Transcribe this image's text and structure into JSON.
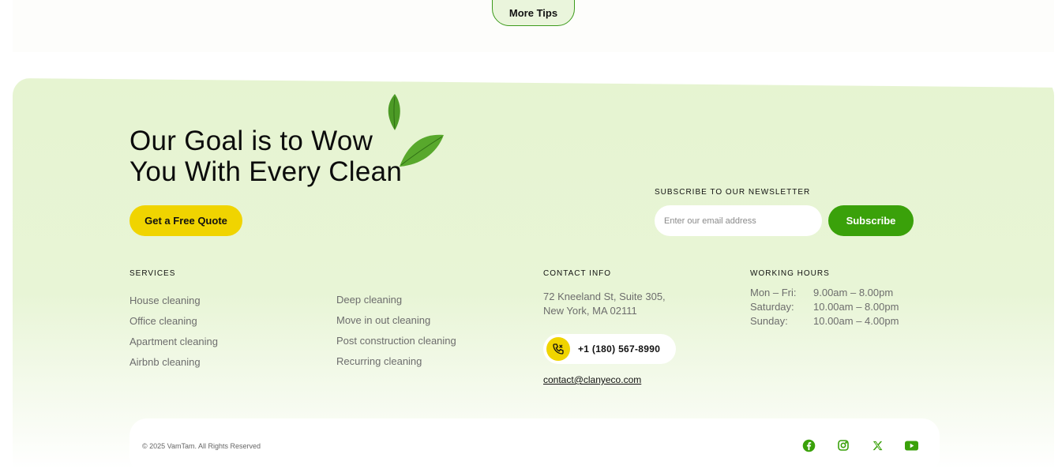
{
  "top": {
    "more_tips_label": "More Tips"
  },
  "hero": {
    "headline_line1": "Our Goal is to Wow",
    "headline_line2": "You With Every Clean",
    "quote_button": "Get a Free Quote"
  },
  "newsletter": {
    "label": "SUBSCRIBE TO OUR NEWSLETTER",
    "placeholder": "Enter our email address",
    "button": "Subscribe"
  },
  "services": {
    "title": "SERVICES",
    "col1": [
      "House cleaning",
      "Office cleaning",
      "Apartment cleaning",
      "Airbnb cleaning"
    ],
    "col2": [
      "Deep cleaning",
      "Move in out cleaning",
      "Post construction cleaning",
      "Recurring cleaning"
    ]
  },
  "contact": {
    "title": "CONTACT INFO",
    "address_line1": "72 Kneeland St, Suite 305,",
    "address_line2": "New York, MA 02111",
    "phone": "+1 (180) 567-8990",
    "email": "contact@clanyeco.com",
    "phone_icon": "phone-icon"
  },
  "hours": {
    "title": "WORKING HOURS",
    "rows": [
      {
        "day": "Mon – Fri:",
        "time": "9.00am – 8.00pm"
      },
      {
        "day": "Saturday:",
        "time": "10.00am – 8.00pm"
      },
      {
        "day": "Sunday:",
        "time": "10.00am – 4.00pm"
      }
    ]
  },
  "bottom": {
    "copyright": "© 2025 VamTam. All Rights Reserved",
    "social": [
      "facebook-icon",
      "instagram-icon",
      "x-icon",
      "youtube-icon"
    ]
  },
  "colors": {
    "accent_green": "#3aa10a",
    "accent_yellow": "#f0d400",
    "footer_bg": "#e6f4d1"
  }
}
